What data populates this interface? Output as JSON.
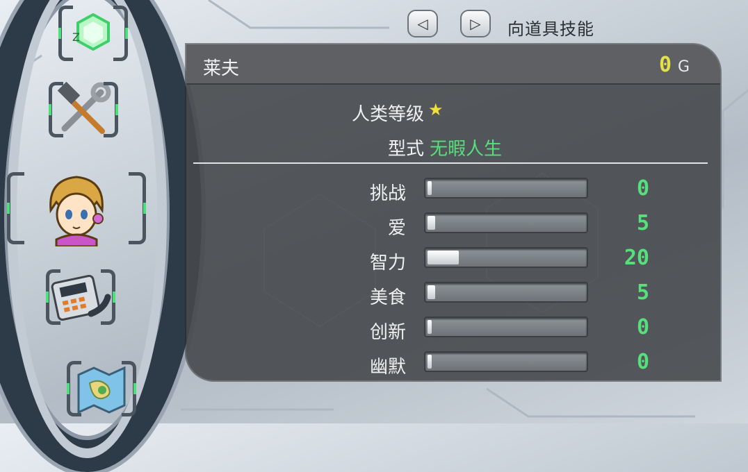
{
  "nav": {
    "prev_icon": "triangle-left-icon",
    "next_icon": "triangle-right-icon",
    "label": "向道具技能"
  },
  "menu": {
    "items": [
      {
        "name": "zone",
        "icon": "hexagon-zone-icon"
      },
      {
        "name": "tools",
        "icon": "hammer-wrench-icon"
      },
      {
        "name": "character",
        "icon": "character-portrait-icon",
        "selected": true
      },
      {
        "name": "device",
        "icon": "handheld-device-icon"
      },
      {
        "name": "map",
        "icon": "map-icon"
      }
    ]
  },
  "character": {
    "name": "莱夫",
    "gold_value": "0",
    "gold_unit": "G",
    "rank_label": "人类等级",
    "rank_stars": "★",
    "style_label": "型式",
    "style_value": "无暇人生"
  },
  "stats": [
    {
      "name": "挑战",
      "value": "0",
      "level": 0
    },
    {
      "name": "爱",
      "value": "5",
      "level": 0.05
    },
    {
      "name": "智力",
      "value": "20",
      "level": 0.2
    },
    {
      "name": "美食",
      "value": "5",
      "level": 0.05
    },
    {
      "name": "创新",
      "value": "0",
      "level": 0
    },
    {
      "name": "幽默",
      "value": "0",
      "level": 0
    }
  ],
  "colors": {
    "stat_value": "#56e07c",
    "gold_value": "#e3e04a",
    "star": "#f1df3c"
  }
}
